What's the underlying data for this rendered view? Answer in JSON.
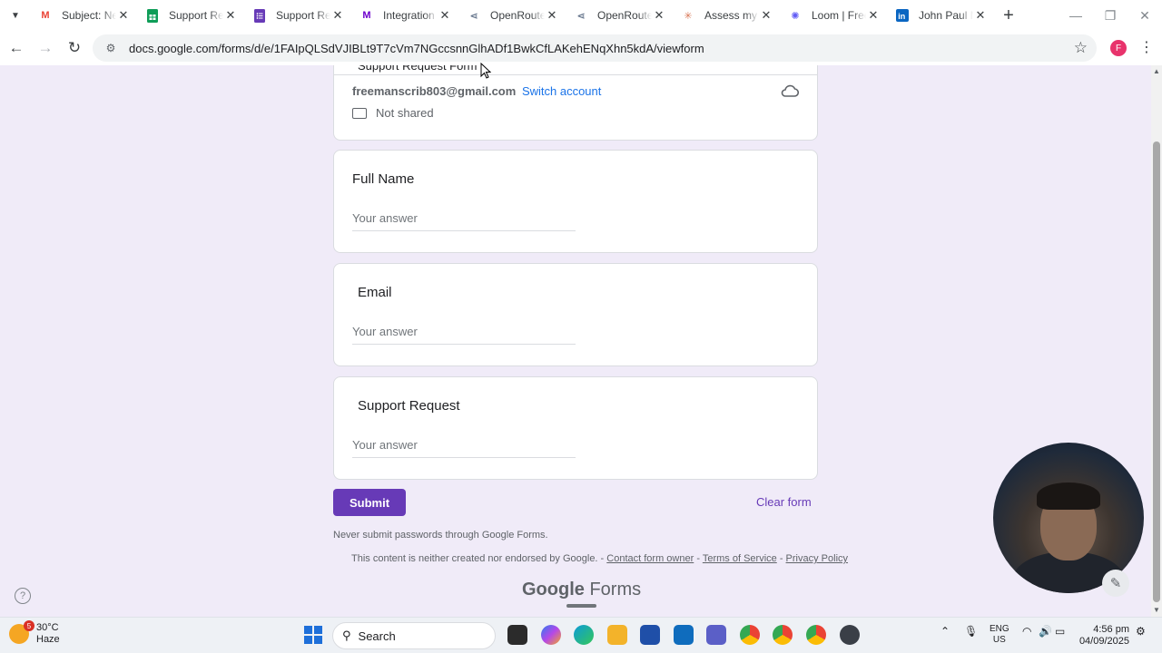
{
  "browser": {
    "tabs": [
      {
        "title": "Subject: New",
        "favicon": "gmail-icon",
        "color": "#ea4335",
        "active": false
      },
      {
        "title": "Support Requ",
        "favicon": "sheets-icon",
        "color": "#0f9d58",
        "active": false
      },
      {
        "title": "Support Requ",
        "favicon": "forms-icon",
        "color": "#673ab7",
        "active": true
      },
      {
        "title": "Integration G",
        "favicon": "make-icon",
        "color": "#6d00cc",
        "active": false
      },
      {
        "title": "OpenRouter",
        "favicon": "openrouter-icon",
        "color": "#64748b",
        "active": false
      },
      {
        "title": "OpenRouter",
        "favicon": "openrouter-icon",
        "color": "#64748b",
        "active": false
      },
      {
        "title": "Assess my ap",
        "favicon": "claude-icon",
        "color": "#d97757",
        "active": false
      },
      {
        "title": "Loom | Free S",
        "favicon": "loom-icon",
        "color": "#625df5",
        "active": false
      },
      {
        "title": "John Paul Ni",
        "favicon": "linkedin-icon",
        "color": "#0a66c2",
        "active": false
      }
    ],
    "url": "docs.google.com/forms/d/e/1FAIpQLSdVJIBLt9T7cVm7NGccsnnGlhADf1BwkCfLAKehENqXhn5kdA/viewform",
    "profile_initial": "F"
  },
  "form": {
    "header_title": "Support Request Form",
    "account_email": "freemanscrib803@gmail.com",
    "switch_account": "Switch account",
    "not_shared": "Not shared",
    "questions": [
      {
        "title": "Full Name",
        "placeholder": "Your answer"
      },
      {
        "title": "Email",
        "placeholder": "Your answer"
      },
      {
        "title": "Support Request",
        "placeholder": "Your answer"
      }
    ],
    "submit_label": "Submit",
    "clear_label": "Clear form",
    "never_submit": "Never submit passwords through Google Forms.",
    "footer_prefix": "This content is neither created nor endorsed by Google. - ",
    "contact_link": "Contact form owner",
    "sep1": " - ",
    "terms_link": "Terms of Service",
    "sep2": " - ",
    "privacy_link": "Privacy Policy",
    "logo_google": "Google",
    "logo_forms": "Forms",
    "accent_color": "#673ab7"
  },
  "taskbar": {
    "weather_temp": "30°C",
    "weather_desc": "Haze",
    "weather_badge": "5",
    "search_label": "Search",
    "lang_line1": "ENG",
    "lang_line2": "US",
    "time": "4:56 pm",
    "date": "04/09/2025"
  }
}
